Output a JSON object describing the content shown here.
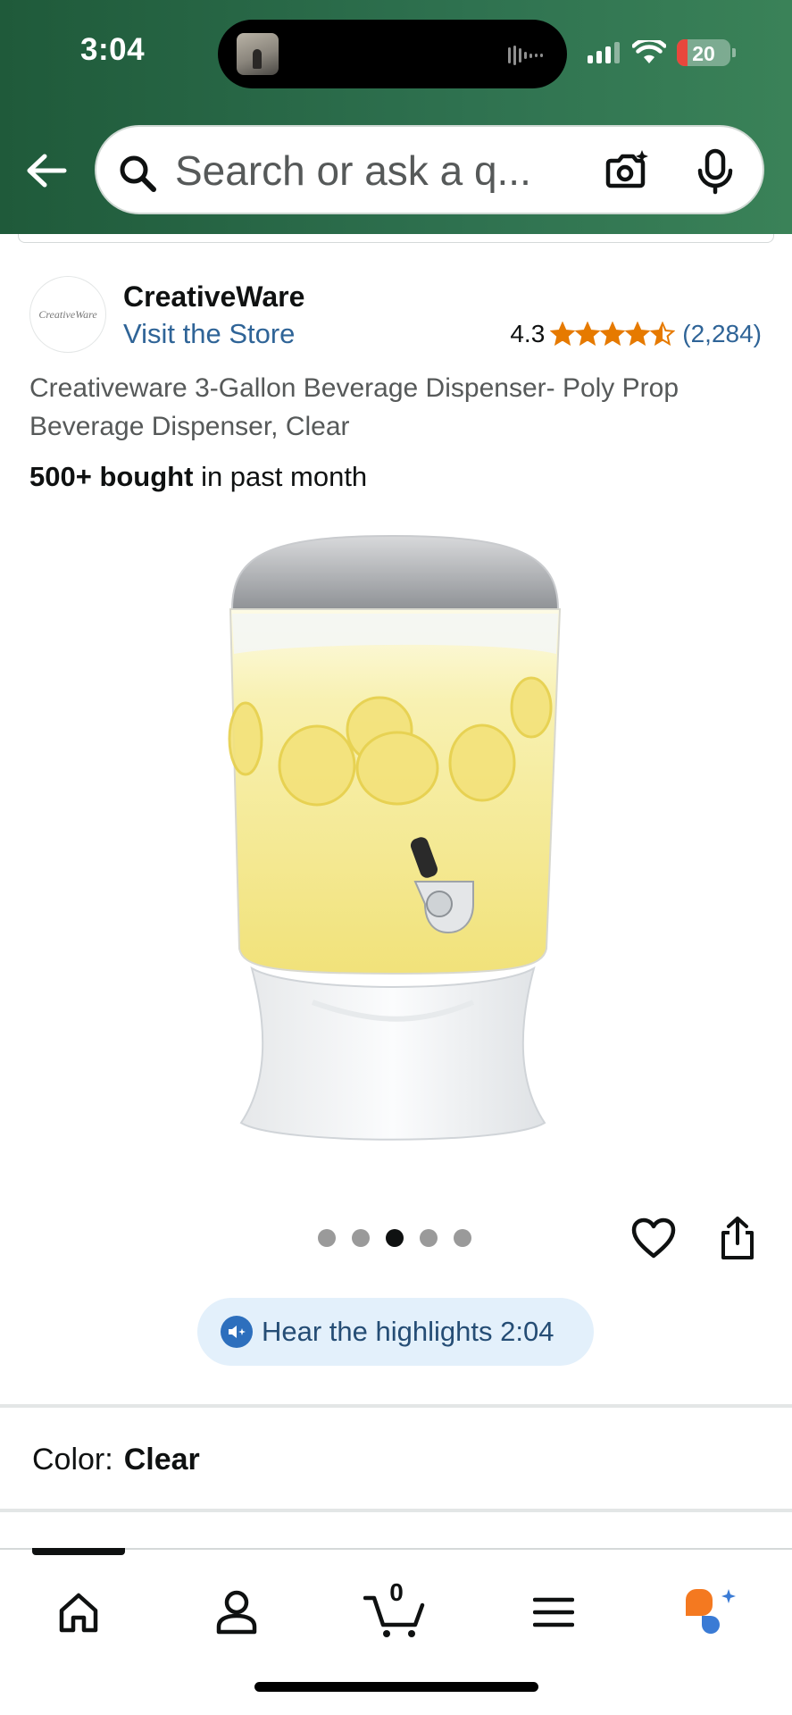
{
  "status_bar": {
    "time": "3:04",
    "battery": "20",
    "battery_level": 0.2
  },
  "search": {
    "placeholder": "Search or ask a q..."
  },
  "brand": {
    "name": "CreativeWare",
    "logo_text": "CreativeWare",
    "visit_store": "Visit the Store"
  },
  "rating": {
    "value": "4.3",
    "stars": 4.3,
    "count": "(2,284)"
  },
  "product": {
    "title": "Creativeware 3-Gallon Beverage Dispenser- Poly Prop Beverage Dispenser, Clear",
    "bought_bold": "500+ bought",
    "bought_rest": " in past month"
  },
  "gallery": {
    "total_images": 5,
    "active_index": 2
  },
  "highlights": {
    "label": "Hear the highlights 2:04"
  },
  "color": {
    "label": "Color:",
    "value": "Clear"
  },
  "bottom_nav": {
    "items": [
      "home-icon",
      "account-icon",
      "cart-icon",
      "menu-icon",
      "rufus-icon"
    ],
    "cart_count": "0"
  },
  "colors": {
    "header_green": "#2a6b48",
    "link_blue": "#2f6497",
    "star_orange": "#e67a00",
    "highlight_bg": "#e3f0fb",
    "battery_red": "#e8473c"
  }
}
